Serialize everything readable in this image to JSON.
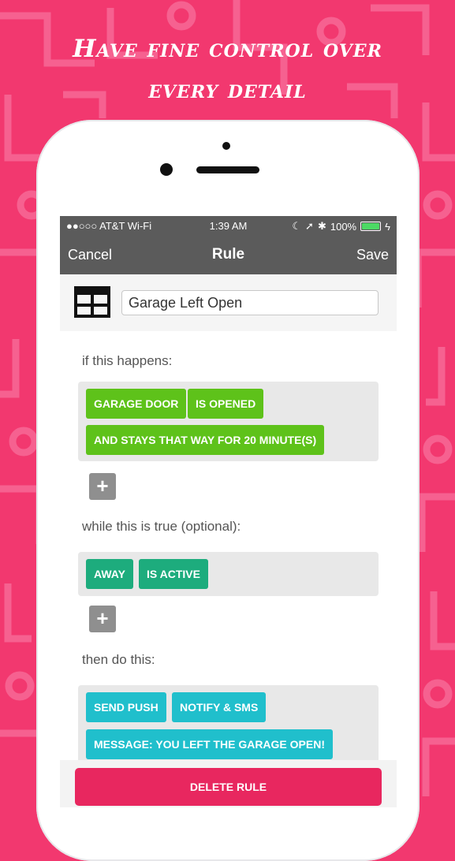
{
  "headline": {
    "line1": "Have fine control over",
    "line2": "every detail"
  },
  "colors": {
    "background": "#f2386f",
    "condition_chip": "#5ec21a",
    "state_chip": "#1dac7d",
    "action_chip": "#20bfcc",
    "delete_button": "#e8275f",
    "topbar": "#5b5b5b"
  },
  "status_bar": {
    "carrier": "●●○○○ AT&T Wi-Fi",
    "time": "1:39 AM",
    "battery": "100%"
  },
  "nav": {
    "cancel": "Cancel",
    "title": "Rule",
    "save": "Save"
  },
  "rule": {
    "icon": "table-grid-icon",
    "name": "Garage Left Open"
  },
  "if_section": {
    "label": "if this happens:",
    "chips": [
      "GARAGE DOOR",
      "IS OPENED",
      "AND STAYS THAT WAY FOR 20 MINUTE(S)"
    ],
    "add": "+"
  },
  "while_section": {
    "label": "while this is true (optional):",
    "chips": [
      "AWAY",
      "IS ACTIVE"
    ],
    "add": "+"
  },
  "then_section": {
    "label": "then do this:",
    "chips": [
      "SEND PUSH",
      "NOTIFY & SMS",
      "MESSAGE: YOU LEFT THE GARAGE OPEN!"
    ]
  },
  "footer": {
    "delete": "DELETE RULE"
  }
}
